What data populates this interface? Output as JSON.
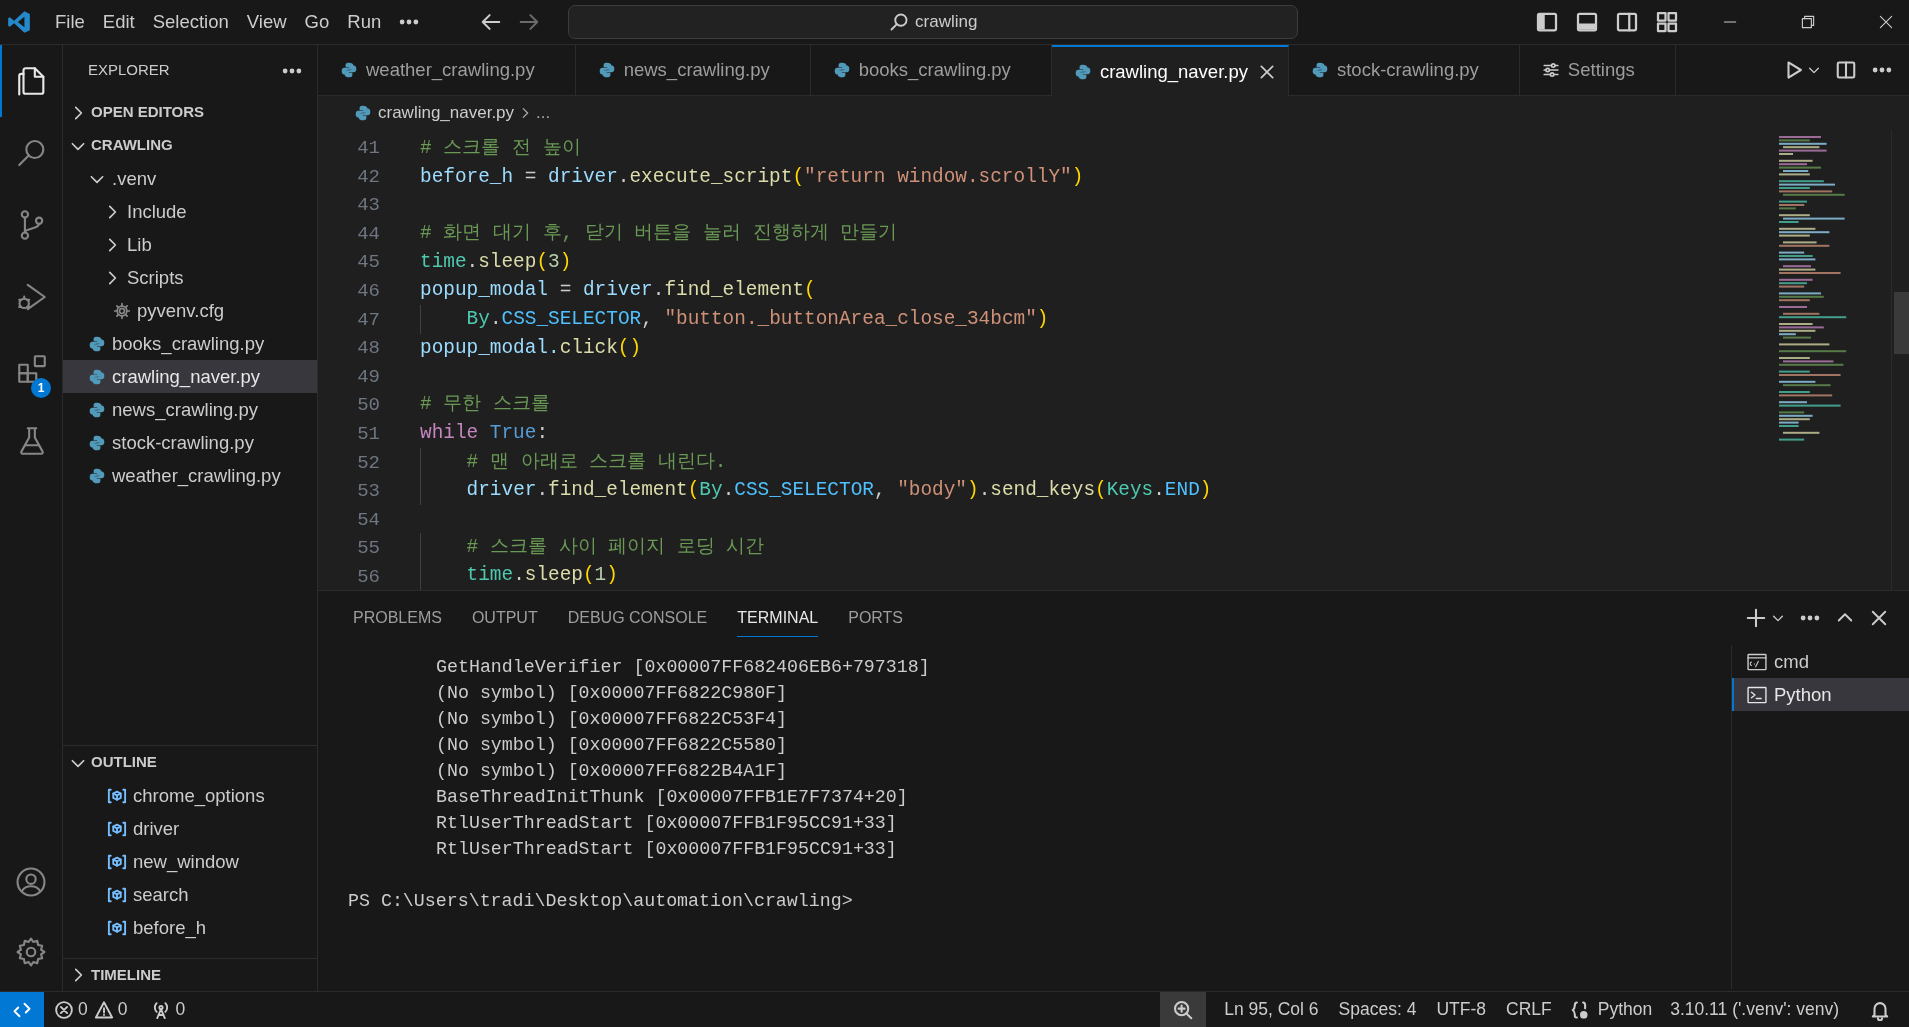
{
  "title_bar": {
    "menu": [
      "File",
      "Edit",
      "Selection",
      "View",
      "Go",
      "Run"
    ],
    "search": {
      "value": "crawling"
    }
  },
  "activity_bar": {
    "items": [
      {
        "kind": "explorer",
        "selected": true
      },
      {
        "kind": "search",
        "selected": false
      },
      {
        "kind": "source-control",
        "selected": false
      },
      {
        "kind": "run-debug",
        "selected": false
      },
      {
        "kind": "extensions",
        "selected": false,
        "badge": "1"
      },
      {
        "kind": "testing",
        "selected": false
      }
    ],
    "bottom": [
      {
        "kind": "account"
      },
      {
        "kind": "settings"
      }
    ]
  },
  "sidebar": {
    "title": "EXPLORER",
    "open_editors": {
      "label": "OPEN EDITORS",
      "expanded": false
    },
    "folder": {
      "label": "CRAWLING",
      "expanded": true,
      "items": [
        {
          "label": ".venv",
          "kind": "folder",
          "expanded": true,
          "selected": false,
          "children": [
            {
              "label": "Include",
              "kind": "folder",
              "expanded": false,
              "selected": false
            },
            {
              "label": "Lib",
              "kind": "folder",
              "expanded": false,
              "selected": false
            },
            {
              "label": "Scripts",
              "kind": "folder",
              "expanded": false,
              "selected": false
            },
            {
              "label": "pyvenv.cfg",
              "kind": "config",
              "selected": false
            }
          ]
        },
        {
          "label": "books_crawling.py",
          "kind": "python",
          "selected": false
        },
        {
          "label": "crawling_naver.py",
          "kind": "python",
          "selected": true
        },
        {
          "label": "news_crawling.py",
          "kind": "python",
          "selected": false
        },
        {
          "label": "stock-crawling.py",
          "kind": "python",
          "selected": false
        },
        {
          "label": "weather_crawling.py",
          "kind": "python",
          "selected": false
        }
      ]
    },
    "outline": {
      "label": "OUTLINE",
      "expanded": true,
      "items": [
        "chrome_options",
        "driver",
        "new_window",
        "search",
        "before_h"
      ]
    },
    "timeline": {
      "label": "TIMELINE",
      "expanded": false
    }
  },
  "editor": {
    "tabs": [
      {
        "label": "weather_crawling.py",
        "kind": "python",
        "selected": false
      },
      {
        "label": "news_crawling.py",
        "kind": "python",
        "selected": false
      },
      {
        "label": "books_crawling.py",
        "kind": "python",
        "selected": false
      },
      {
        "label": "crawling_naver.py",
        "kind": "python",
        "selected": true
      },
      {
        "label": "stock-crawling.py",
        "kind": "python",
        "selected": false
      },
      {
        "label": "Settings",
        "kind": "settings",
        "selected": false
      }
    ],
    "breadcrumb": [
      "crawling_naver.py",
      "..."
    ],
    "lines": [
      {
        "number": "41",
        "tokens": [
          {
            "kind": "comment",
            "text": "# 스크롤 전 높이"
          }
        ]
      },
      {
        "number": "42",
        "tokens": [
          {
            "kind": "variable",
            "text": "before_h"
          },
          {
            "kind": "punctuation",
            "text": " = "
          },
          {
            "kind": "variable",
            "text": "driver"
          },
          {
            "kind": "punctuation",
            "text": "."
          },
          {
            "kind": "function",
            "text": "execute_script"
          },
          {
            "kind": "bracket",
            "text": "("
          },
          {
            "kind": "string",
            "text": "\"return window.scrollY\""
          },
          {
            "kind": "bracket",
            "text": ")"
          }
        ]
      },
      {
        "number": "43"
      },
      {
        "number": "44",
        "tokens": [
          {
            "kind": "comment",
            "text": "# 화면 대기 후, 닫기 버튼을 눌러 진행하게 만들기"
          }
        ]
      },
      {
        "number": "45",
        "tokens": [
          {
            "kind": "class",
            "text": "time"
          },
          {
            "kind": "punctuation",
            "text": "."
          },
          {
            "kind": "function",
            "text": "sleep"
          },
          {
            "kind": "bracket",
            "text": "("
          },
          {
            "kind": "number",
            "text": "3"
          },
          {
            "kind": "bracket",
            "text": ")"
          }
        ]
      },
      {
        "number": "46",
        "tokens": [
          {
            "kind": "variable",
            "text": "popup_modal"
          },
          {
            "kind": "punctuation",
            "text": " = "
          },
          {
            "kind": "variable",
            "text": "driver"
          },
          {
            "kind": "punctuation",
            "text": "."
          },
          {
            "kind": "function",
            "text": "find_element"
          },
          {
            "kind": "bracket",
            "text": "("
          }
        ]
      },
      {
        "number": "47",
        "indented": true,
        "tokens": [
          {
            "kind": "class",
            "text": "By"
          },
          {
            "kind": "punctuation",
            "text": "."
          },
          {
            "kind": "constant",
            "text": "CSS_SELECTOR"
          },
          {
            "kind": "punctuation",
            "text": ", "
          },
          {
            "kind": "string",
            "text": "\"button._buttonArea_close_34bcm\""
          },
          {
            "kind": "bracket",
            "text": ")"
          }
        ]
      },
      {
        "number": "48",
        "tokens": [
          {
            "kind": "variable",
            "text": "popup_modal."
          },
          {
            "kind": "function",
            "text": "click"
          },
          {
            "kind": "bracket",
            "text": "()"
          }
        ]
      },
      {
        "number": "49"
      },
      {
        "number": "50",
        "tokens": [
          {
            "kind": "comment",
            "text": "# 무한 스크롤"
          }
        ]
      },
      {
        "number": "51",
        "tokens": [
          {
            "kind": "keyword",
            "text": "while "
          },
          {
            "kind": "boolean",
            "text": "True"
          },
          {
            "kind": "punctuation",
            "text": ":"
          }
        ]
      },
      {
        "number": "52",
        "indented": true,
        "tokens": [
          {
            "kind": "comment",
            "text": "# 맨 아래로 스크롤 내린다."
          }
        ]
      },
      {
        "number": "53",
        "indented": true,
        "tokens": [
          {
            "kind": "variable",
            "text": "driver"
          },
          {
            "kind": "punctuation",
            "text": "."
          },
          {
            "kind": "function",
            "text": "find_element"
          },
          {
            "kind": "bracket",
            "text": "("
          },
          {
            "kind": "class",
            "text": "By"
          },
          {
            "kind": "punctuation",
            "text": "."
          },
          {
            "kind": "constant",
            "text": "CSS_SELECTOR"
          },
          {
            "kind": "punctuation",
            "text": ", "
          },
          {
            "kind": "string",
            "text": "\"body\""
          },
          {
            "kind": "bracket",
            "text": ")"
          },
          {
            "kind": "punctuation",
            "text": "."
          },
          {
            "kind": "function",
            "text": "send_keys"
          },
          {
            "kind": "bracket",
            "text": "("
          },
          {
            "kind": "class",
            "text": "Keys"
          },
          {
            "kind": "punctuation",
            "text": "."
          },
          {
            "kind": "constant",
            "text": "END"
          },
          {
            "kind": "bracket",
            "text": ")"
          }
        ]
      },
      {
        "number": "54"
      },
      {
        "number": "55",
        "indented": true,
        "tokens": [
          {
            "kind": "comment",
            "text": "# 스크롤 사이 페이지 로딩 시간"
          }
        ]
      },
      {
        "number": "56",
        "indented": true,
        "tokens": [
          {
            "kind": "class",
            "text": "time"
          },
          {
            "kind": "punctuation",
            "text": "."
          },
          {
            "kind": "function",
            "text": "sleep"
          },
          {
            "kind": "bracket",
            "text": "("
          },
          {
            "kind": "number",
            "text": "1"
          },
          {
            "kind": "bracket",
            "text": ")"
          }
        ]
      }
    ]
  },
  "panel": {
    "tabs": [
      {
        "label": "PROBLEMS",
        "selected": false
      },
      {
        "label": "OUTPUT",
        "selected": false
      },
      {
        "label": "DEBUG CONSOLE",
        "selected": false
      },
      {
        "label": "TERMINAL",
        "selected": true
      },
      {
        "label": "PORTS",
        "selected": false
      }
    ],
    "stack_trace": [
      "GetHandleVerifier [0x00007FF682406EB6+797318]",
      "(No symbol) [0x00007FF6822C980F]",
      "(No symbol) [0x00007FF6822C53F4]",
      "(No symbol) [0x00007FF6822C5580]",
      "(No symbol) [0x00007FF6822B4A1F]",
      "BaseThreadInitThunk [0x00007FFB1E7F7374+20]",
      "RtlUserThreadStart [0x00007FFB1F95CC91+33]",
      "RtlUserThreadStart [0x00007FFB1F95CC91+33]"
    ],
    "prompt": "PS C:\\Users\\tradi\\Desktop\\automation\\crawling>",
    "terminals": [
      {
        "label": "cmd",
        "kind": "cmd",
        "selected": false
      },
      {
        "label": "Python",
        "kind": "shell",
        "selected": true
      }
    ]
  },
  "status_bar": {
    "left": [
      {
        "kind": "errors",
        "text": "0"
      },
      {
        "kind": "warnings",
        "text": "0"
      },
      {
        "kind": "ports",
        "text": "0"
      }
    ],
    "right": [
      {
        "kind": "zoom"
      },
      {
        "kind": "text",
        "text": "Ln 95, Col 6"
      },
      {
        "kind": "text",
        "text": "Spaces: 4"
      },
      {
        "kind": "text",
        "text": "UTF-8"
      },
      {
        "kind": "text",
        "text": "CRLF"
      },
      {
        "kind": "language",
        "text": "Python"
      },
      {
        "kind": "text",
        "text": "3.10.11 ('.venv': venv)"
      },
      {
        "kind": "bell"
      }
    ]
  }
}
